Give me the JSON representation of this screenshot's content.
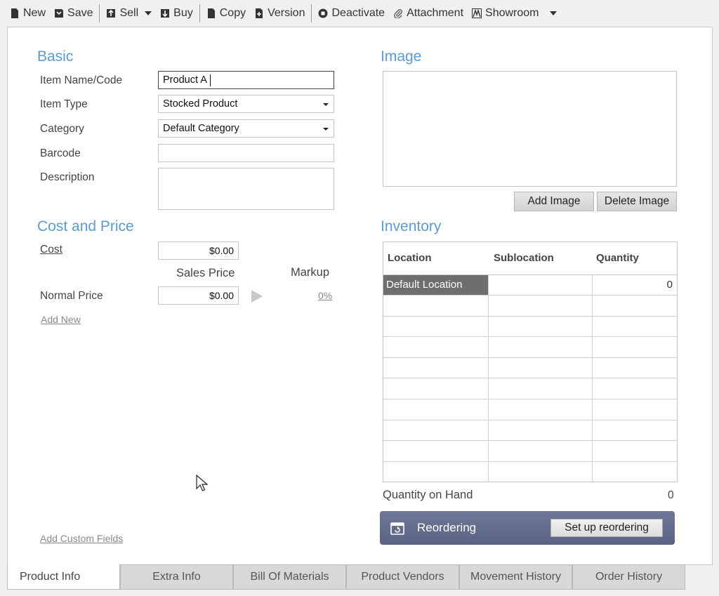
{
  "toolbar": {
    "new": "New",
    "save": "Save",
    "sell": "Sell",
    "buy": "Buy",
    "copy": "Copy",
    "version": "Version",
    "deactivate": "Deactivate",
    "attachment": "Attachment",
    "showroom": "Showroom"
  },
  "basic": {
    "title": "Basic",
    "item_name_label": "Item Name/Code",
    "item_name_value": "Product A",
    "item_type_label": "Item Type",
    "item_type_value": "Stocked Product",
    "category_label": "Category",
    "category_value": "Default Category",
    "barcode_label": "Barcode",
    "barcode_value": "",
    "description_label": "Description",
    "description_value": ""
  },
  "cost_price": {
    "title": "Cost and Price",
    "cost_label": "Cost",
    "cost_value": "$0.00",
    "sales_price_header": "Sales Price",
    "markup_header": "Markup",
    "normal_price_label": "Normal Price",
    "normal_price_value": "$0.00",
    "markup_value": "0%",
    "add_new": "Add New"
  },
  "add_custom_fields": "Add Custom Fields",
  "image": {
    "title": "Image",
    "add": "Add Image",
    "delete": "Delete Image"
  },
  "inventory": {
    "title": "Inventory",
    "columns": [
      "Location",
      "Sublocation",
      "Quantity"
    ],
    "rows": [
      {
        "location": "Default Location",
        "sublocation": "",
        "quantity": "0"
      }
    ],
    "qoh_label": "Quantity on Hand",
    "qoh_value": "0"
  },
  "reorder": {
    "label": "Reordering",
    "button": "Set up reordering"
  },
  "tabs": [
    "Product Info",
    "Extra Info",
    "Bill Of Materials",
    "Product Vendors",
    "Movement History",
    "Order History"
  ],
  "colors": {
    "accent": "#5b9bd5",
    "reorder_bar": "#5f6a88",
    "selected_cell": "#6e6e6e"
  }
}
